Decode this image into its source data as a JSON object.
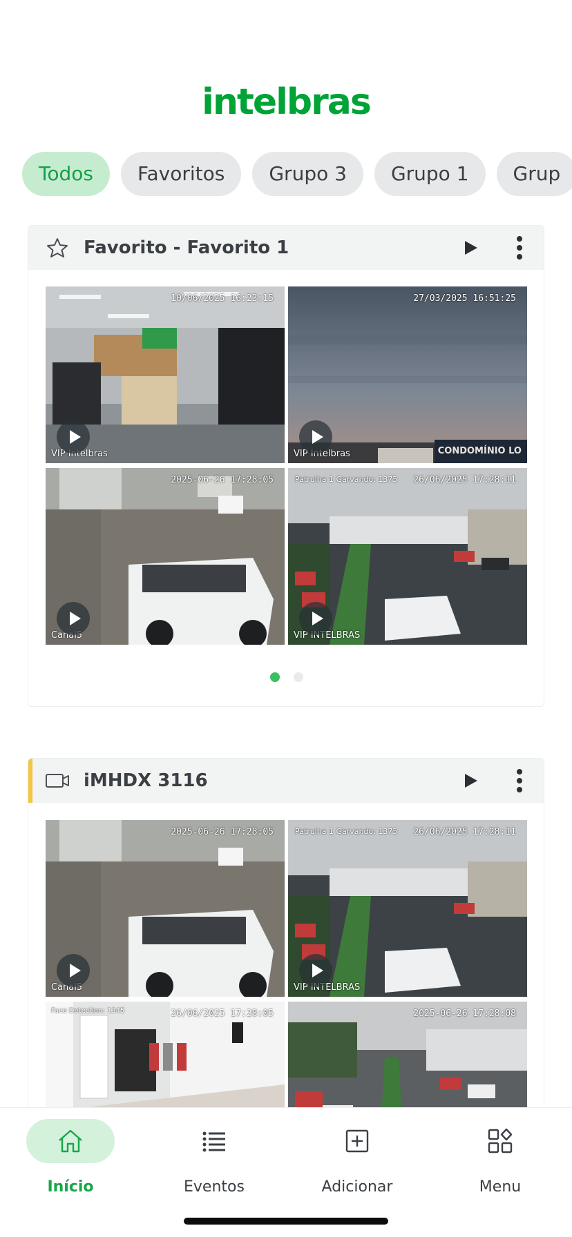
{
  "brand": {
    "logo_text": "intelbras",
    "accent": "#00a335"
  },
  "filters": {
    "chips": [
      {
        "label": "Todos",
        "active": true
      },
      {
        "label": "Favoritos",
        "active": false
      },
      {
        "label": "Grupo 3",
        "active": false
      },
      {
        "label": "Grupo 1",
        "active": false
      },
      {
        "label": "Grup",
        "active": false
      }
    ]
  },
  "favorites_card": {
    "title": "Favorito - Favorito 1",
    "icon": "star-icon",
    "tiles": [
      {
        "timestamp": "10/06/2025 16:23:15",
        "label": "VIP Intelbras"
      },
      {
        "timestamp": "27/03/2025 16:51:25",
        "label": "VIP Intelbras",
        "overlay": "CONDOMÍNIO LO"
      },
      {
        "timestamp": "2025-06-26 17:28:05",
        "label": "Canal5"
      },
      {
        "timestamp": "26/06/2025 17:28:11",
        "label": "VIP INTELBRAS",
        "caption": "Patrulha 1 Garvando: 1375"
      }
    ],
    "pagination": {
      "pages": 2,
      "current": 1
    }
  },
  "device_card": {
    "title": "iMHDX 3116",
    "icon": "camera-icon",
    "accent": "#f6c443",
    "tiles": [
      {
        "timestamp": "2025-06-26 17:28:05",
        "label": "Canal5"
      },
      {
        "timestamp": "26/06/2025 17:28:11",
        "label": "VIP INTELBRAS",
        "caption": "Patrulha 1 Garvando: 1375"
      },
      {
        "timestamp": "26/06/2025 17:28:05",
        "caption": "Face Detection: 1345"
      },
      {
        "timestamp": "2025-06-26 17:28:08"
      }
    ]
  },
  "bottom_nav": {
    "items": [
      {
        "label": "Início",
        "icon": "home-icon",
        "active": true
      },
      {
        "label": "Eventos",
        "icon": "list-icon",
        "active": false
      },
      {
        "label": "Adicionar",
        "icon": "add-icon",
        "active": false
      },
      {
        "label": "Menu",
        "icon": "menu-grid-icon",
        "active": false
      }
    ]
  }
}
